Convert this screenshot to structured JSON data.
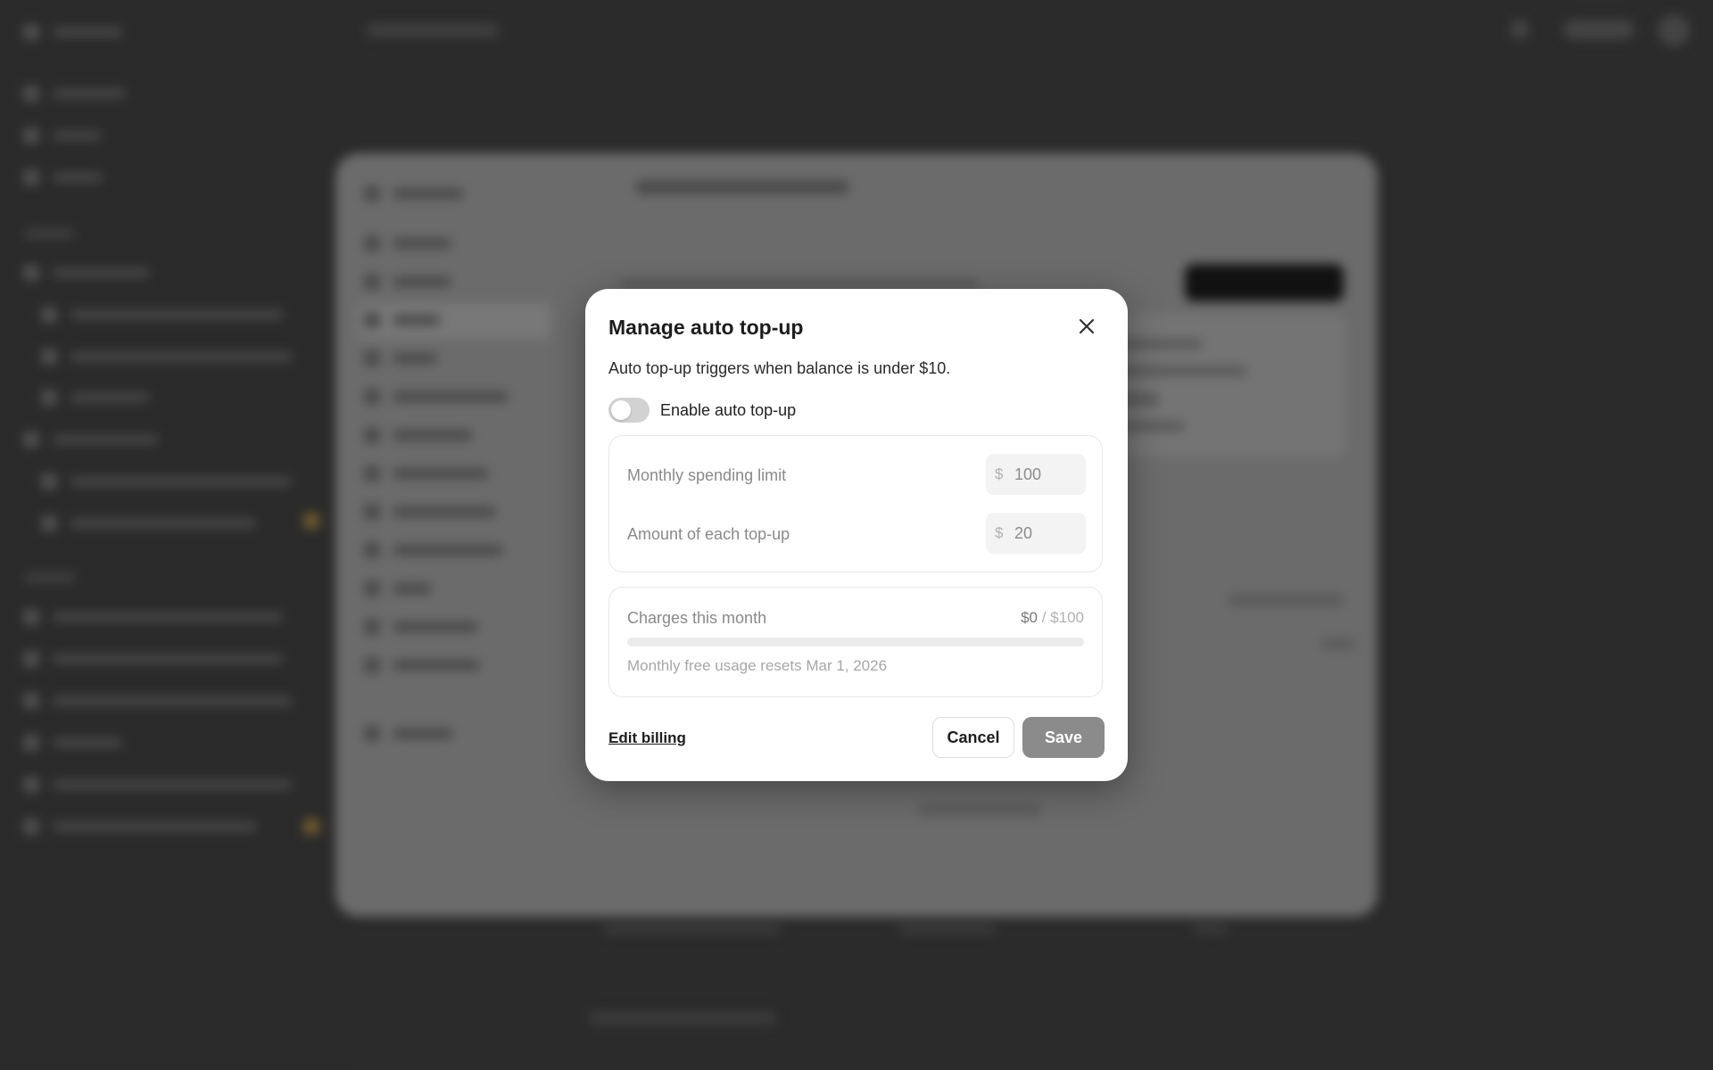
{
  "dialog": {
    "title": "Manage auto top-up",
    "description": "Auto top-up triggers when balance is under $10.",
    "toggle": {
      "label": "Enable auto top-up",
      "enabled": false
    },
    "monthly_limit": {
      "label": "Monthly spending limit",
      "currency": "$",
      "value": "100"
    },
    "topup_amount": {
      "label": "Amount of each top-up",
      "currency": "$",
      "value": "20"
    },
    "charges": {
      "label": "Charges this month",
      "used": "$0",
      "separator": " / ",
      "limit": "$100",
      "progress": 0,
      "reset_note": "Monthly free usage resets Mar 1, 2026"
    },
    "edit_billing_label": "Edit billing",
    "cancel_label": "Cancel",
    "save_label": "Save"
  },
  "colors": {
    "overlay_bg": "#2b2b2b",
    "dialog_bg": "#ffffff",
    "save_disabled": "#8b8b8b",
    "toggle_off": "#d2d2d2"
  }
}
